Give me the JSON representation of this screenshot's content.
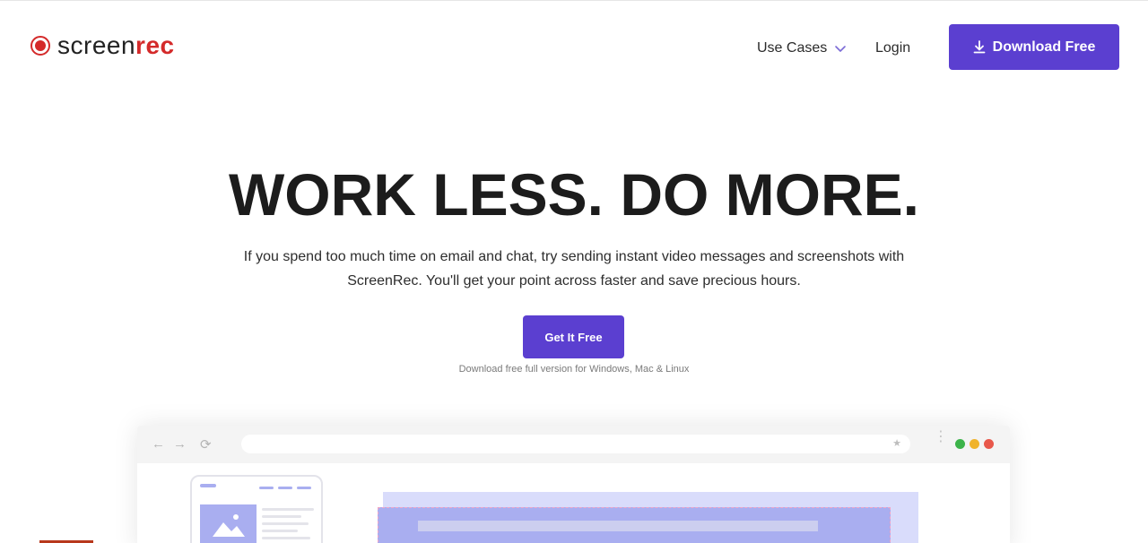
{
  "header": {
    "logo": {
      "part1": "screen",
      "part2": "rec"
    },
    "nav": {
      "use_cases": "Use Cases",
      "login": "Login"
    },
    "download_button": "Download Free"
  },
  "hero": {
    "title": "WORK LESS. DO MORE.",
    "subtitle": "If you spend too much time on email and chat, try sending instant video messages and screenshots with ScreenRec. You'll get your point across faster and save precious hours.",
    "cta": "Get It Free",
    "note": "Download free full version for Windows, Mac & Linux"
  },
  "mockup": {
    "icons": [
      "back-arrow-icon",
      "forward-arrow-icon",
      "reload-icon",
      "star-icon",
      "menu-icon"
    ],
    "window_dots": [
      "#3cb34a",
      "#f0b32b",
      "#e8584b"
    ]
  },
  "colors": {
    "accent": "#5b3fd0",
    "brand_red": "#d42a2a"
  }
}
